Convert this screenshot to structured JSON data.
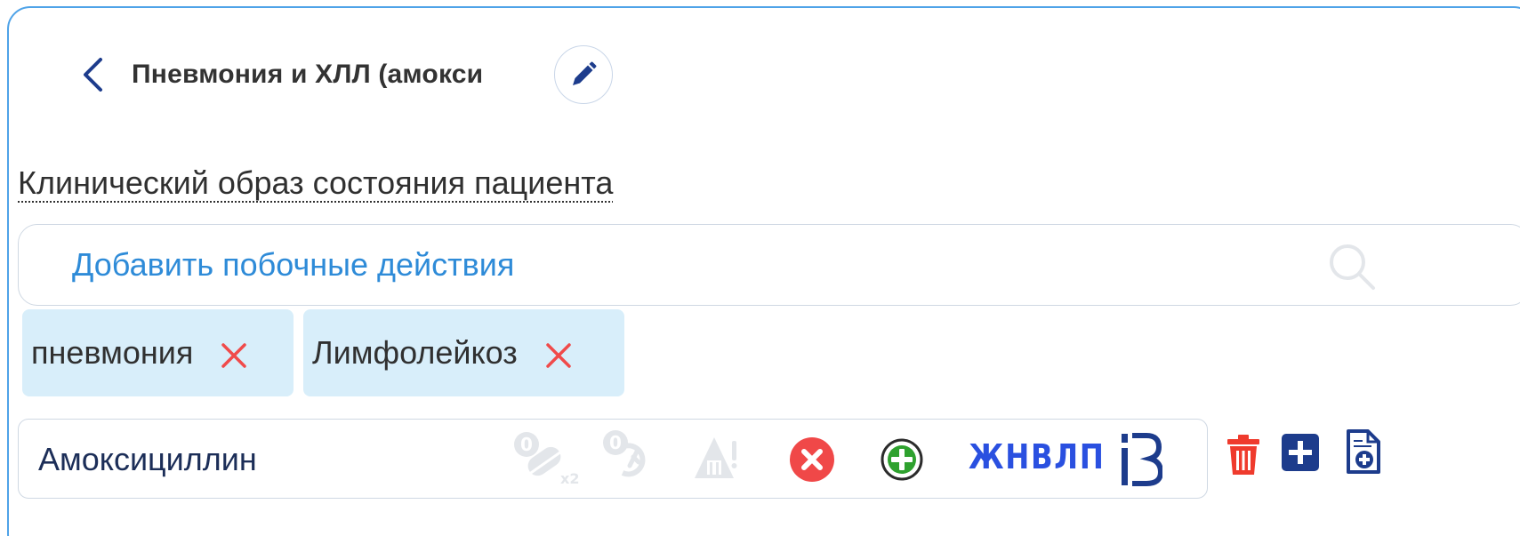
{
  "header": {
    "title": "Пневмония и ХЛЛ (амоксициллин)"
  },
  "section": {
    "label": "Клинический образ состояния пациента"
  },
  "search": {
    "placeholder": "Добавить побочные действия",
    "value": ""
  },
  "tags": [
    {
      "label": "пневмония"
    },
    {
      "label": "Лимфолейкоз"
    }
  ],
  "drug": {
    "name": "Амоксициллин",
    "zhnvlp_label": "ЖНВЛП",
    "icons": {
      "interaction_counter": "0",
      "rotation_counter": "0",
      "dose_multiplier": "x2"
    }
  },
  "colors": {
    "accent": "#2e8bd8",
    "border": "#4fa3e8",
    "tag_bg": "#d8eefa",
    "remove_red": "#f04a4a",
    "delete_red": "#ef3b2d",
    "add_green": "#2ea12e",
    "navy": "#1d3c8c",
    "zhnvlp_blue": "#2a50e0"
  }
}
